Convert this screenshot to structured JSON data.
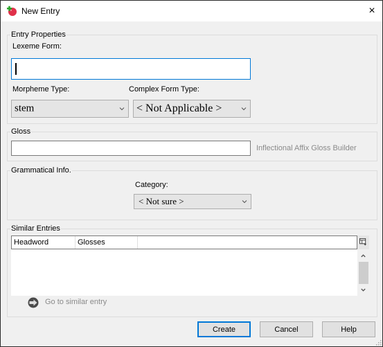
{
  "window": {
    "title": "New Entry",
    "close_label": "×"
  },
  "entry_properties": {
    "group_label": "Entry Properties",
    "lexeme_form_label": "Lexeme Form:",
    "lexeme_form_value": "",
    "morpheme_type_label": "Morpheme Type:",
    "morpheme_type_value": "stem",
    "complex_form_type_label": "Complex Form Type:",
    "complex_form_type_value": "< Not Applicable >"
  },
  "gloss": {
    "group_label": "Gloss",
    "value": "",
    "affix_builder_label": "Inflectional Affix Gloss Builder"
  },
  "grammatical_info": {
    "group_label": "Grammatical Info.",
    "category_label": "Category:",
    "category_value": "< Not sure >"
  },
  "similar_entries": {
    "group_label": "Similar Entries",
    "columns": [
      "Headword",
      "Glosses"
    ],
    "rows": [],
    "go_to_label": "Go to similar entry"
  },
  "buttons": {
    "create": "Create",
    "cancel": "Cancel",
    "help": "Help"
  },
  "colors": {
    "focus": "#0078d7",
    "disabled_text": "#8a8a8a"
  }
}
